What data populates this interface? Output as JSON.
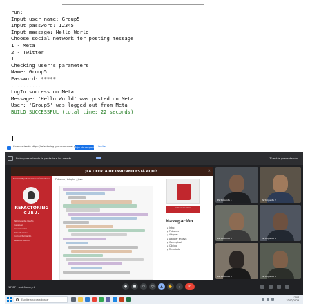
{
  "console": {
    "lines": [
      "run:",
      "Input user name: Group5",
      "Input password: 12345",
      "Input message: Hello World",
      "",
      "Choose social network for posting message.",
      "1 - Meta",
      "2 - Twitter",
      "1",
      "",
      "Checking user's parameters",
      "Name: Group5",
      "Password: *****",
      "..........",
      "",
      "LogIn success on Meta",
      "Message: 'Hello World' was posted on Meta",
      "User: 'Group5' was logged out from Meta",
      "BUILD SUCCESSFUL (total time: 22 seconds)"
    ],
    "success_color": "#1f7a1f"
  },
  "meet": {
    "share_bar": {
      "text": "Compartiendo https://refactoring.guru con meet.google.com",
      "stop_label": "Dejar de compartir",
      "hide_label": "Ocultar"
    },
    "top_bar": {
      "presenting_text": "Estás presentando la pestaña a los demás",
      "right_text": "Tú estás presentando"
    },
    "presentation": {
      "banner": "¡LA OFERTA DE INVIERNO ESTÁ AQUÍ!",
      "site_logo_line1": "REFACTORING",
      "site_logo_line2": "GURU.",
      "site_nav": [
        "Premium",
        "Español",
        "Iniciar sesión",
        "Contacto"
      ],
      "site_menu": [
        "Patrones de diseño",
        "Catálogo",
        "Creacionales",
        "Estructurales",
        "Comportamiento",
        "Refactorización"
      ],
      "breadcrumb": "Patrones / Adapter / Java",
      "buy_label": "Comprar el libro",
      "nav_title": "Navegación",
      "nav_items": [
        "Intro",
        "Patrones",
        "Adapter",
        "Adapter en Java",
        "Conceptual",
        "Código",
        "Resultado"
      ]
    },
    "participants": [
      {
        "name": "Participante 1"
      },
      {
        "name": "Participante 2"
      },
      {
        "name": "Participante 3"
      },
      {
        "name": "Participante 4"
      },
      {
        "name": "Participante 5"
      },
      {
        "name": "Participante 6"
      }
    ],
    "controls": {
      "meeting_info": "17:07 | asd-fweo-yrt",
      "icons": [
        "mic-icon",
        "camera-icon",
        "captions-icon",
        "reaction-icon",
        "present-icon",
        "raise-hand-icon",
        "more-icon",
        "end-call-icon"
      ]
    },
    "taskbar": {
      "search_placeholder": "Escribe aquí para buscar",
      "time": "17:07",
      "date": "22/02/2023"
    }
  }
}
